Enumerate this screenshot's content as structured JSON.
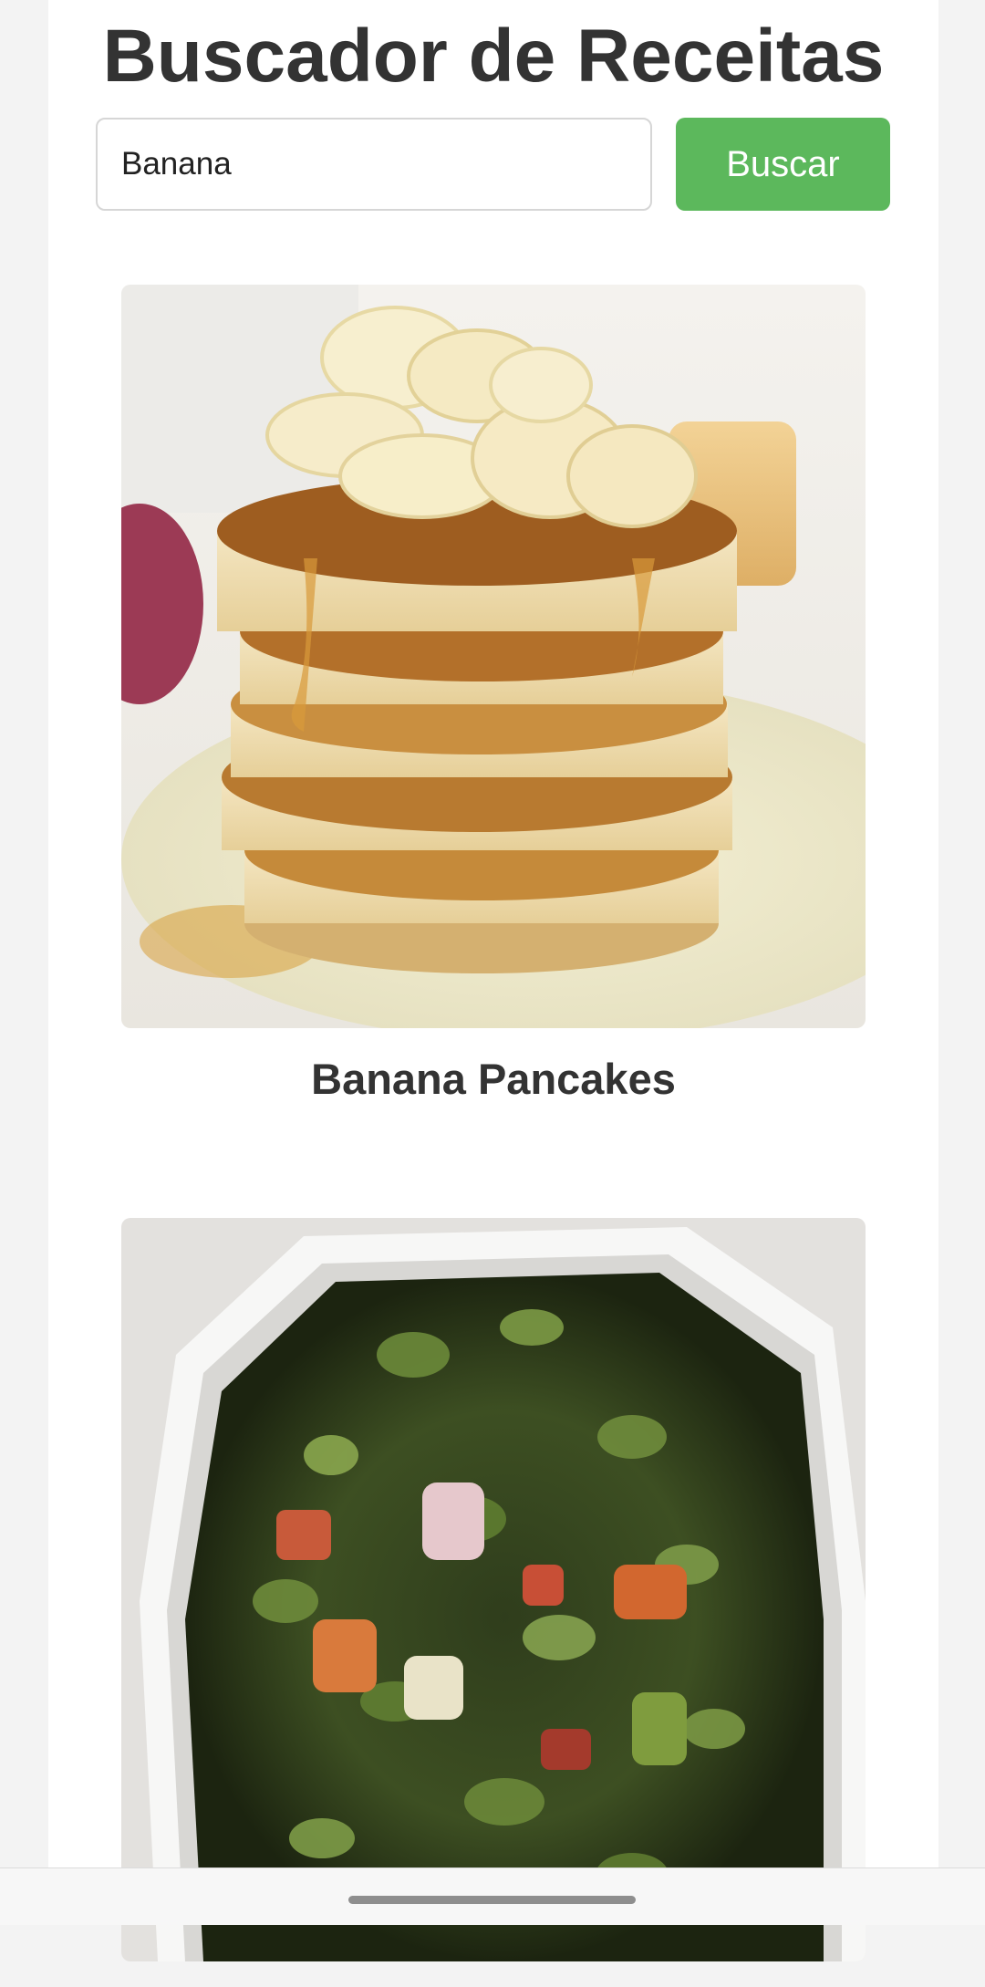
{
  "header": {
    "title": "Buscador de Receitas"
  },
  "search": {
    "value": "Banana",
    "button_label": "Buscar"
  },
  "recipes": [
    {
      "name": "Banana Pancakes"
    },
    {
      "name": ""
    }
  ],
  "colors": {
    "accent": "#5cb85c",
    "title": "#333333",
    "page_background": "#f3f3f3"
  }
}
